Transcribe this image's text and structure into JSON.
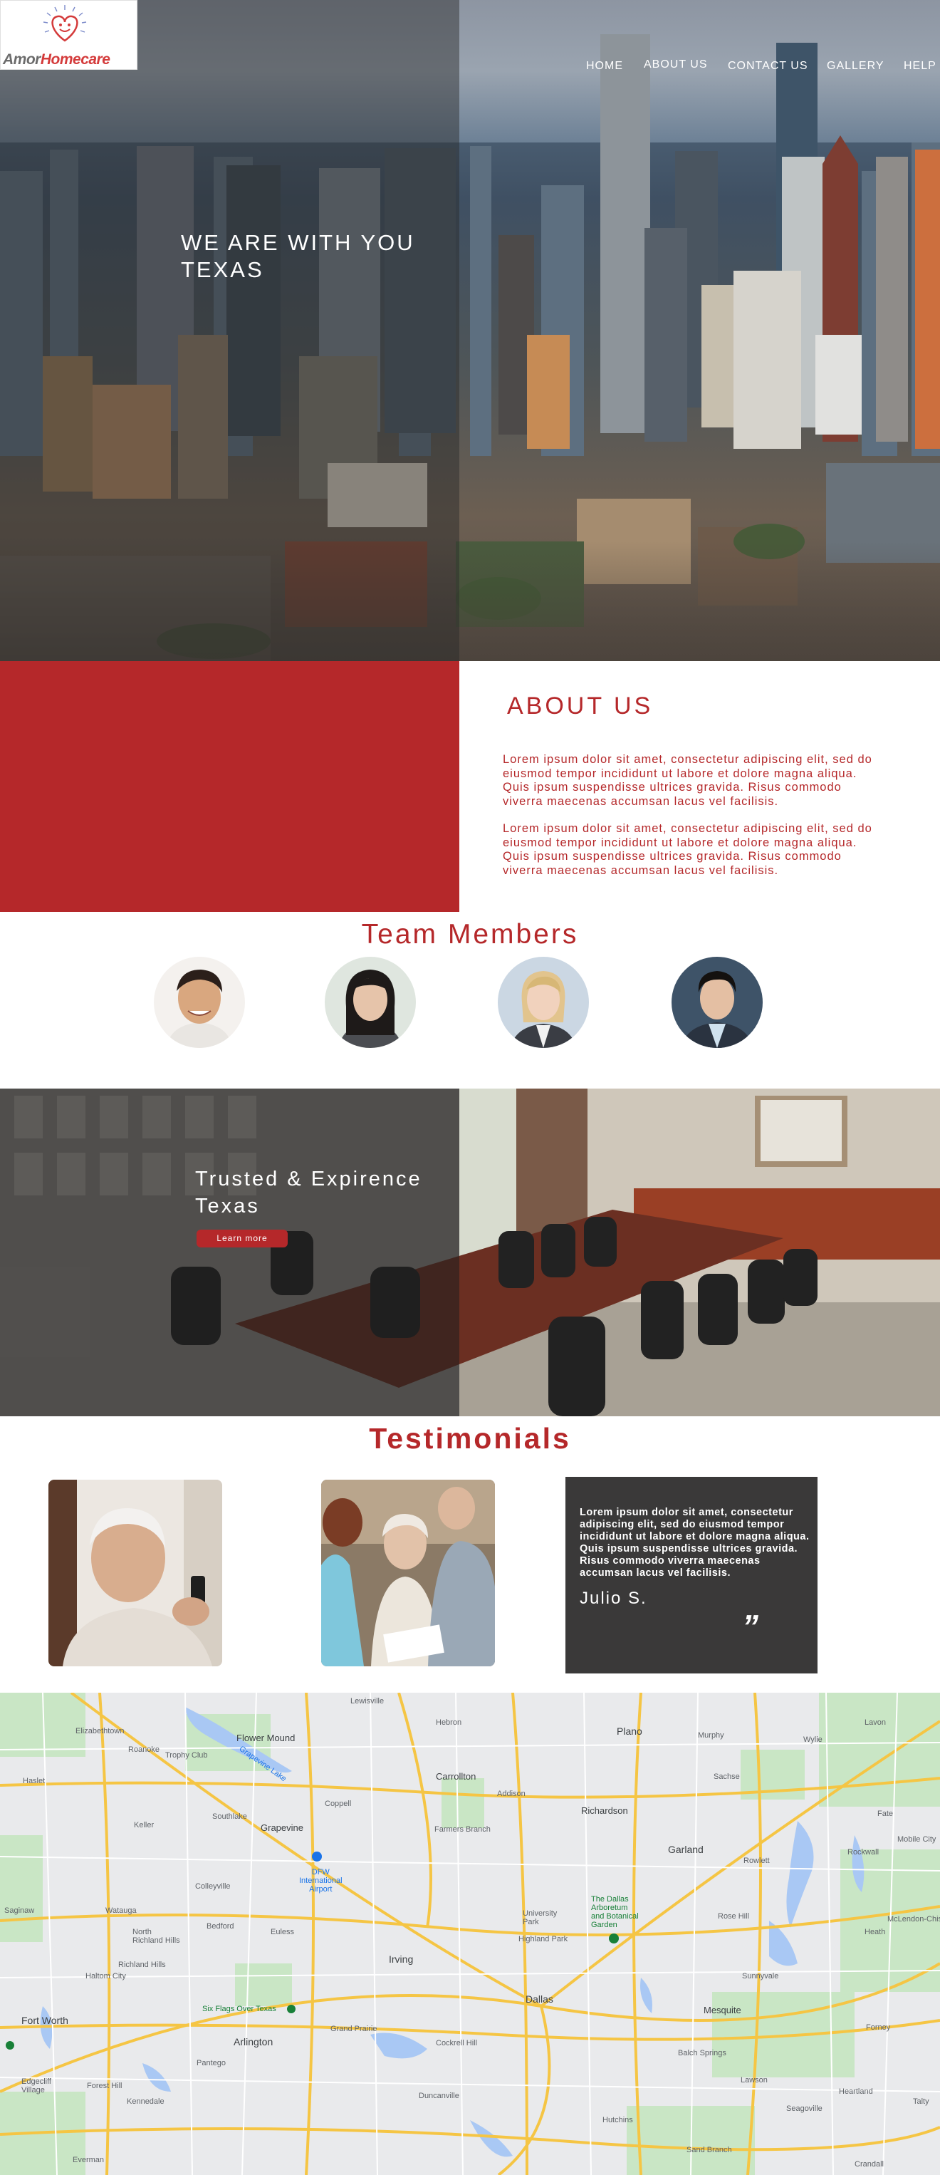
{
  "logo": {
    "brand_part1": "Amor",
    "brand_part2": "Homecare"
  },
  "nav": {
    "items": [
      {
        "label": "HOME"
      },
      {
        "label": "ABOUT US"
      },
      {
        "label": "CONTACT US"
      },
      {
        "label": "GALLERY"
      },
      {
        "label": "HELP"
      }
    ]
  },
  "hero": {
    "title_line1": "WE ARE WITH YOU",
    "title_line2": "TEXAS"
  },
  "about": {
    "heading": "ABOUT US",
    "paragraph1": "Lorem ipsum dolor sit amet, consectetur adipiscing elit, sed do eiusmod tempor incididunt ut labore et dolore magna aliqua. Quis ipsum suspendisse ultrices gravida. Risus commodo viverra maecenas accumsan lacus vel facilisis.",
    "paragraph2": "Lorem ipsum dolor sit amet, consectetur adipiscing elit, sed do eiusmod tempor incididunt ut labore et dolore magna aliqua. Quis ipsum suspendisse ultrices gravida. Risus commodo viverra maecenas accumsan lacus vel facilisis."
  },
  "team": {
    "heading": "Team Members"
  },
  "trusted": {
    "title_line1": "Trusted & Expirence",
    "title_line2": "Texas",
    "button_label": "Learn more"
  },
  "testimonials": {
    "heading": "Testimonials",
    "quote": "Lorem ipsum dolor sit amet, consectetur adipiscing elit, sed do eiusmod tempor incididunt ut labore et dolore magna aliqua. Quis ipsum suspendisse ultrices gravida. Risus commodo viverra maecenas accumsan lacus vel facilisis.",
    "author": "Julio S.",
    "quote_mark": "”"
  },
  "map": {
    "labels": {
      "lewisville": "Lewisville",
      "elizabethtown": "Elizabethtown",
      "flower_mound": "Flower Mound",
      "trophy_club": "Trophy Club",
      "roanoke": "Roanoke",
      "grapevine_lake": "Grapevine Lake",
      "hebron": "Hebron",
      "carrollton": "Carrollton",
      "addison": "Addison",
      "plano": "Plano",
      "murphy": "Murphy",
      "wylie": "Wylie",
      "lavon": "Lavon",
      "sachse": "Sachse",
      "haslet": "Haslet",
      "southlake": "Southlake",
      "coppell": "Coppell",
      "grapevine": "Grapevine",
      "keller": "Keller",
      "farmers_branch": "Farmers Branch",
      "richardson": "Richardson",
      "garland": "Garland",
      "rowlett": "Rowlett",
      "rockwall": "Rockwall",
      "fate": "Fate",
      "mobile_city": "Mobile City",
      "dfw": "DFW\nInternational\nAirport",
      "colleyville": "Colleyville",
      "watauga": "Watauga",
      "saginaw": "Saginaw",
      "bedford": "Bedford",
      "euless": "Euless",
      "north_richland_hills": "North\nRichland Hills",
      "university_park": "University\nPark",
      "highland_park": "Highland Park",
      "dallas_arboretum": "The Dallas\nArboretum\nand Botanical\nGarden",
      "rose_hill": "Rose Hill",
      "heath": "Heath",
      "mclendon": "McLendon-Chisholm",
      "richland_hills": "Richland Hills",
      "haltom_city": "Haltom City",
      "irving": "Irving",
      "dallas": "Dallas",
      "sunnyvale": "Sunnyvale",
      "fort_worth": "Fort Worth",
      "six_flags": "Six Flags Over Texas",
      "arlington": "Arlington",
      "grand_prairie": "Grand Prairie",
      "mesquite": "Mesquite",
      "balch_springs": "Balch Springs",
      "forney": "Forney",
      "cockrell_hill": "Cockrell Hill",
      "pantego": "Pantego",
      "lawson": "Lawson",
      "heartland": "Heartland",
      "talty": "Talty",
      "edgecliff": "Edgecliff\nVillage",
      "forest_hill": "Forest Hill",
      "kennedale": "Kennedale",
      "duncanville": "Duncanville",
      "hutchins": "Hutchins",
      "seagoville": "Seagoville",
      "sand_branch": "Sand Branch",
      "everman": "Everman",
      "crandall": "Crandall"
    }
  }
}
